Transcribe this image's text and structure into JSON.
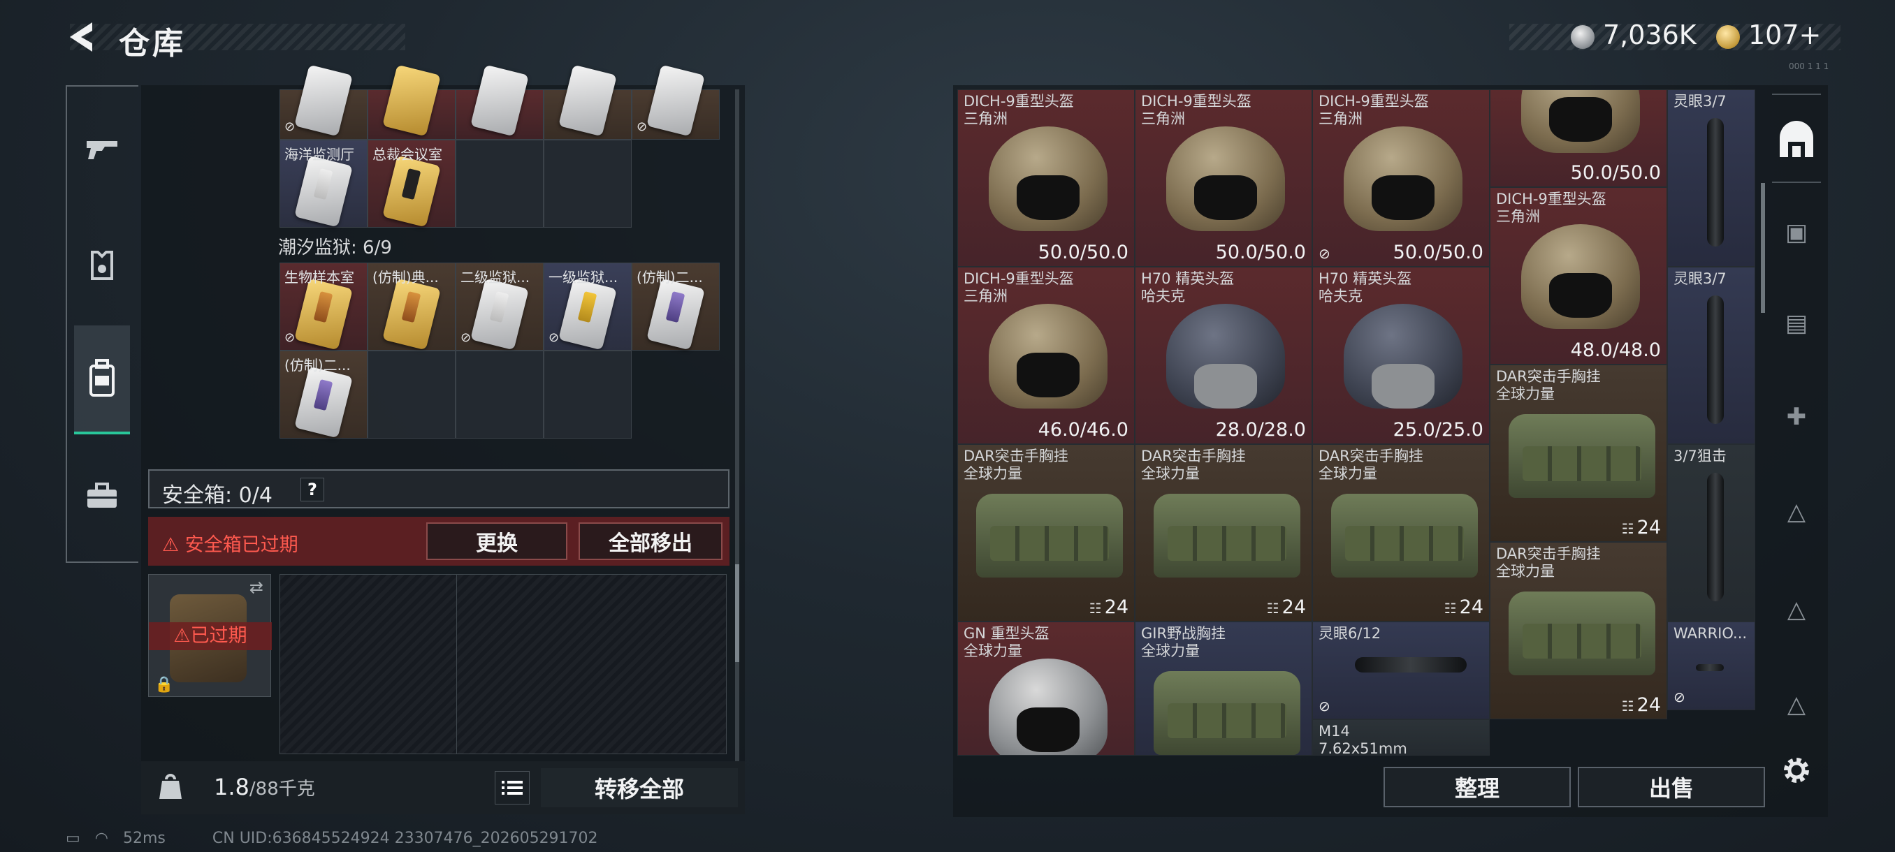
{
  "header": {
    "title": "仓库",
    "currency_silver": "7,036K",
    "currency_gold": "107+",
    "corner_text": "000 1 1 1"
  },
  "left_panel": {
    "top_row_cells": [
      "",
      "",
      "",
      "",
      ""
    ],
    "row2_labels": [
      "海洋监测厅",
      "总裁会议室"
    ],
    "section_label": "潮汐监狱: 6/9",
    "prison_labels": [
      "生物样本室",
      "(仿制)典...",
      "二级监狱...",
      "一级监狱...",
      "(仿制)二...",
      "(仿制)二..."
    ],
    "safe_box_label": "安全箱: 0/4",
    "safe_box_help": "?",
    "expired_warning": "安全箱已过期",
    "replace_button": "更换",
    "move_all_button": "全部移出",
    "expired_tag": "已过期",
    "weight_value": "1.8",
    "weight_max": "/88千克",
    "transfer_all_button": "转移全部"
  },
  "status": {
    "ping": "52ms",
    "uid": "CN UID:636845524924 23307476_202605291702"
  },
  "right_panel": {
    "items": [
      {
        "name": "DICH-9重型头盔",
        "sub": "三角洲",
        "value": "50.0/50.0"
      },
      {
        "name": "DICH-9重型头盔",
        "sub": "三角洲",
        "value": "50.0/50.0"
      },
      {
        "name": "DICH-9重型头盔",
        "sub": "三角洲",
        "value": "50.0/50.0"
      },
      {
        "name": "",
        "sub": "",
        "value": "50.0/50.0"
      },
      {
        "name": "灵眼3/7",
        "sub": "",
        "value": ""
      },
      {
        "name": "DICH-9重型头盔",
        "sub": "三角洲",
        "value": "48.0/48.0"
      },
      {
        "name": "DICH-9重型头盔",
        "sub": "三角洲",
        "value": "46.0/46.0"
      },
      {
        "name": "H70 精英头盔",
        "sub": "哈夫克",
        "value": "28.0/28.0"
      },
      {
        "name": "H70 精英头盔",
        "sub": "哈夫克",
        "value": "25.0/25.0"
      },
      {
        "name": "灵眼3/7",
        "sub": "",
        "value": ""
      },
      {
        "name": "DAR突击手胸挂",
        "sub": "全球力量",
        "count": "24"
      },
      {
        "name": "DAR突击手胸挂",
        "sub": "全球力量",
        "count": "24"
      },
      {
        "name": "DAR突击手胸挂",
        "sub": "全球力量",
        "count": "24"
      },
      {
        "name": "DAR突击手胸挂",
        "sub": "全球力量",
        "count": "24"
      },
      {
        "name": "3/7狙击",
        "sub": "",
        "value": ""
      },
      {
        "name": "DAR突击手胸挂",
        "sub": "全球力量",
        "count": "24"
      },
      {
        "name": "GN 重型头盔",
        "sub": "全球力量",
        "value": ""
      },
      {
        "name": "GIR野战胸挂",
        "sub": "全球力量",
        "value": ""
      },
      {
        "name": "灵眼6/12",
        "sub": "",
        "value": ""
      },
      {
        "name": "WARRIO...",
        "sub": "",
        "value": ""
      },
      {
        "name": "M14",
        "sub": "7.62x51mm",
        "value": ""
      }
    ],
    "sort_button": "整理",
    "sell_button": "出售"
  }
}
